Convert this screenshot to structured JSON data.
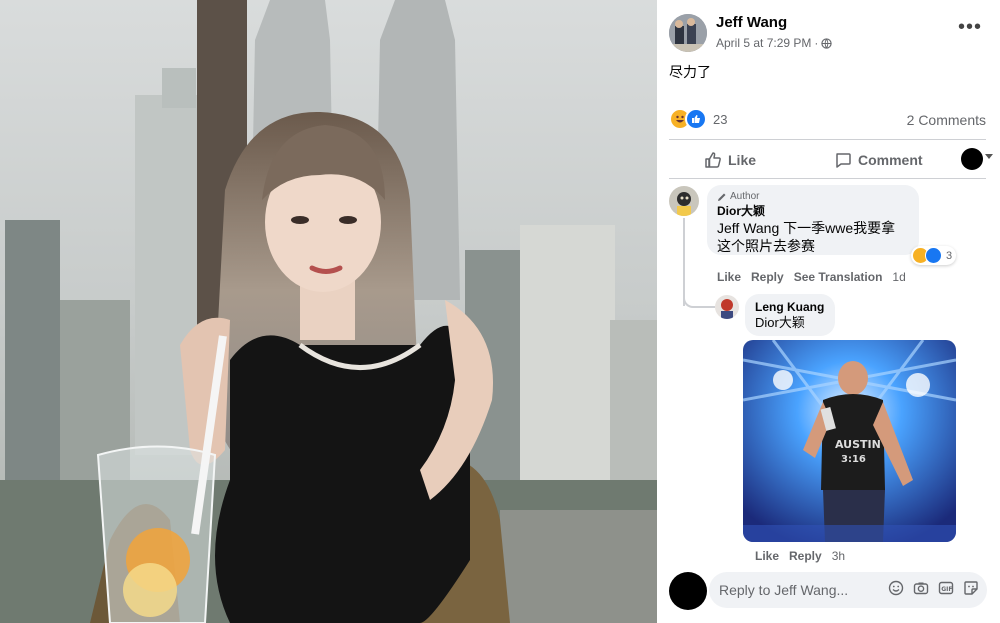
{
  "post": {
    "author": "Jeff Wang",
    "date": "April 5 at 7:29 PM",
    "separator": "·",
    "text": "尽力了",
    "reaction_count": "23",
    "comments_count": "2 Comments"
  },
  "actions": {
    "like": "Like",
    "comment": "Comment"
  },
  "comments": [
    {
      "badge": "Author",
      "name": "Dior大颖",
      "text_line1": "Jeff Wang 下一季wwe我要拿",
      "text_line2": "这个照片去参赛",
      "reaction_count": "3",
      "actions": {
        "like": "Like",
        "reply": "Reply",
        "translate": "See Translation",
        "time": "1d"
      }
    },
    {
      "name": "Leng Kuang",
      "text": "Dior大颖",
      "actions": {
        "like": "Like",
        "reply": "Reply",
        "time": "3h"
      }
    }
  ],
  "reply_box": {
    "placeholder": "Reply to Jeff Wang..."
  },
  "colors": {
    "like_blue": "#1877f2",
    "haha_yellow": "#f7b125",
    "text_secondary": "#65676b",
    "bubble": "#f0f2f5"
  }
}
